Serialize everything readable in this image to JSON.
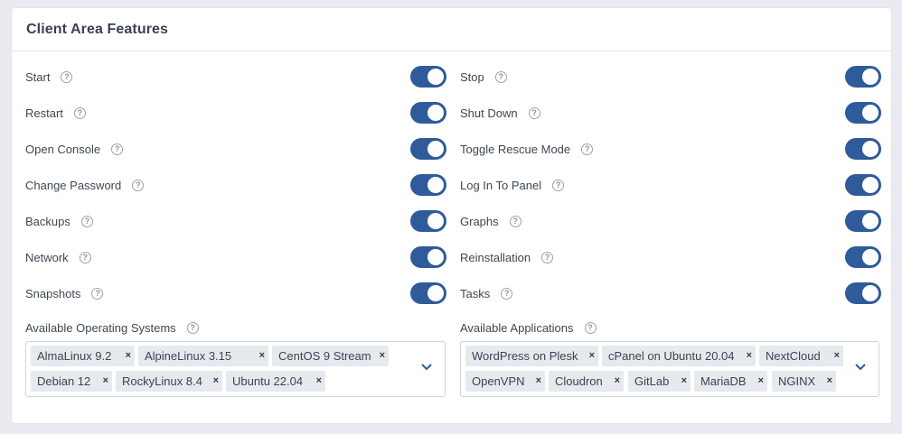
{
  "card": {
    "title": "Client Area Features"
  },
  "features_left": [
    {
      "label": "Start",
      "on": true
    },
    {
      "label": "Restart",
      "on": true
    },
    {
      "label": "Open Console",
      "on": true
    },
    {
      "label": "Change Password",
      "on": true
    },
    {
      "label": "Backups",
      "on": true
    },
    {
      "label": "Network",
      "on": true
    },
    {
      "label": "Snapshots",
      "on": true
    }
  ],
  "features_right": [
    {
      "label": "Stop",
      "on": true
    },
    {
      "label": "Shut Down",
      "on": true
    },
    {
      "label": "Toggle Rescue Mode",
      "on": true
    },
    {
      "label": "Log In To Panel",
      "on": true
    },
    {
      "label": "Graphs",
      "on": true
    },
    {
      "label": "Reinstallation",
      "on": true
    },
    {
      "label": "Tasks",
      "on": true
    }
  ],
  "os": {
    "label": "Available Operating Systems",
    "tags": [
      "AlmaLinux 9.2",
      "AlpineLinux 3.15",
      "CentOS 9 Stream",
      "Debian 12",
      "RockyLinux 8.4",
      "Ubuntu 22.04"
    ]
  },
  "apps": {
    "label": "Available Applications",
    "tags": [
      "WordPress on Plesk",
      "cPanel on Ubuntu 20.04",
      "NextCloud",
      "OpenVPN",
      "Cloudron",
      "GitLab",
      "MariaDB",
      "NGINX"
    ]
  },
  "icons": {
    "help": "help-circle-icon",
    "remove": "remove-x-icon",
    "dropdown": "chevron-down-icon"
  },
  "colors": {
    "toggle_on": "#2f5b9a",
    "tag_bg": "#e6e9ee",
    "page_bg": "#e9ebf0"
  }
}
